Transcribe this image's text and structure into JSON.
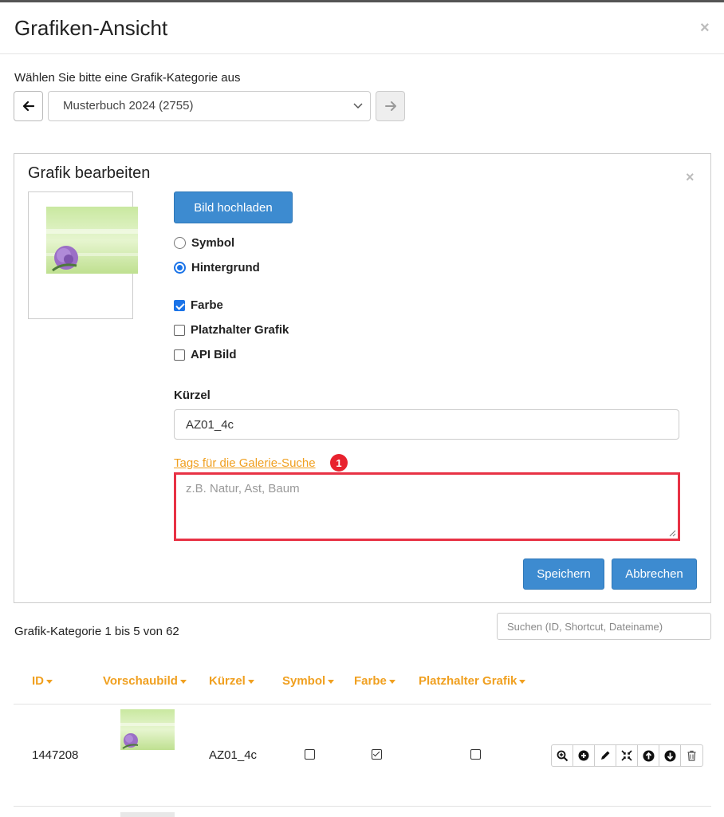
{
  "modal": {
    "title": "Grafiken-Ansicht",
    "close": "×"
  },
  "category": {
    "label": "Wählen Sie bitte eine Grafik-Kategorie aus",
    "selected": "Musterbuch 2024 (2755)"
  },
  "edit_panel": {
    "title": "Grafik bearbeiten",
    "close": "×",
    "upload_label": "Bild hochladen",
    "type_options": [
      {
        "label": "Symbol",
        "checked": false
      },
      {
        "label": "Hintergrund",
        "checked": true
      }
    ],
    "flags": [
      {
        "label": "Farbe",
        "checked": true
      },
      {
        "label": "Platzhalter Grafik",
        "checked": false
      },
      {
        "label": "API Bild",
        "checked": false
      }
    ],
    "shortcut_label": "Kürzel",
    "shortcut_value": "AZ01_4c",
    "tags_label": "Tags für die Galerie-Suche",
    "tags_badge": "1",
    "tags_placeholder": "z.B. Natur, Ast, Baum",
    "save_label": "Speichern",
    "cancel_label": "Abbrechen"
  },
  "list": {
    "count_text": "Grafik-Kategorie 1 bis 5 von 62",
    "search_placeholder": "Suchen (ID, Shortcut, Dateiname)",
    "columns": [
      "ID",
      "Vorschaubild",
      "Kürzel",
      "Symbol",
      "Farbe",
      "Platzhalter Grafik"
    ],
    "rows": [
      {
        "id": "1447208",
        "shortcut": "AZ01_4c",
        "symbol": false,
        "farbe": true,
        "platzhalter": false
      }
    ],
    "row_actions": [
      "zoom-in-icon",
      "plus-circle-icon",
      "pencil-icon",
      "compress-icon",
      "arrow-up-circle-icon",
      "arrow-down-circle-icon",
      "trash-icon"
    ]
  },
  "colors": {
    "accent_blue": "#3d8bd0",
    "header_orange": "#f0a020",
    "highlight_red": "#e83245"
  }
}
